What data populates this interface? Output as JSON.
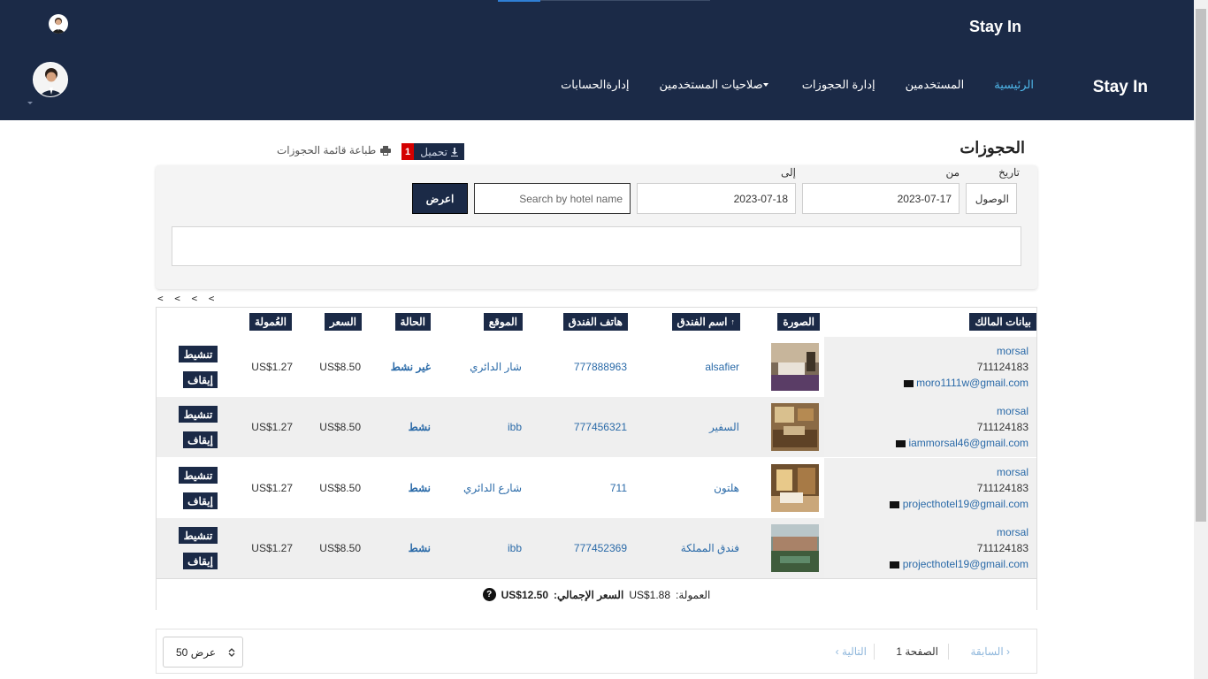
{
  "header": {
    "brand_small": "Stay In",
    "brand_main": "Stay In",
    "nav": [
      {
        "label": "الرئيسية",
        "active": true
      },
      {
        "label": "المستخدمين",
        "active": false
      },
      {
        "label": "إدارة الحجوزات",
        "active": false
      },
      {
        "label": "صلاحيات المستخدمين",
        "active": false,
        "dropdown": true
      },
      {
        "label": "إدارةالحسابات",
        "active": false
      }
    ]
  },
  "page": {
    "title": "الحجوزات",
    "download_label": "تحميل",
    "download_badge": "1",
    "print_label": "طباعة قائمة الحجوزات"
  },
  "filters": {
    "date_label": "تاريخ",
    "from_label": "من",
    "to_label": "إلى",
    "date_type_value": "الوصول",
    "from_value": "2023-07-17",
    "to_value": "2023-07-18",
    "search_placeholder": "Search by hotel name",
    "show_button": "اعرض"
  },
  "pager_arrows": "< < < <",
  "table": {
    "headers": {
      "owner": "بيانات المالك",
      "image": "الصورة",
      "hotel_name": "اسم الفندق",
      "hotel_phone": "هاتف الفندق",
      "location": "الموقع",
      "status": "الحالة",
      "price": "السعر",
      "commission": "العُمولة"
    },
    "rows": [
      {
        "owner_name": "morsal",
        "owner_phone": "711124183",
        "owner_email": "moro1111w@gmail.com",
        "hotel_name": "alsafier",
        "hotel_phone": "777888963",
        "location": "شار الدائري",
        "status": "غير نشط",
        "price": "US$8.50",
        "commission": "US$1.27",
        "activate": "تنشيط",
        "stop": "إيقاف"
      },
      {
        "owner_name": "morsal",
        "owner_phone": "711124183",
        "owner_email": "iammorsal46@gmail.com",
        "hotel_name": "السفير",
        "hotel_phone": "777456321",
        "location": "ibb",
        "status": "نشط",
        "price": "US$8.50",
        "commission": "US$1.27",
        "activate": "تنشيط",
        "stop": "إيقاف"
      },
      {
        "owner_name": "morsal",
        "owner_phone": "711124183",
        "owner_email": "projecthotel19@gmail.com",
        "hotel_name": "هلتون",
        "hotel_phone": "711",
        "location": "شارع الدائري",
        "status": "نشط",
        "price": "US$8.50",
        "commission": "US$1.27",
        "activate": "تنشيط",
        "stop": "إيقاف"
      },
      {
        "owner_name": "morsal",
        "owner_phone": "711124183",
        "owner_email": "projecthotel19@gmail.com",
        "hotel_name": "فندق المملكة",
        "hotel_phone": "777452369",
        "location": "ibb",
        "status": "نشط",
        "price": "US$8.50",
        "commission": "US$1.27",
        "activate": "تنشيط",
        "stop": "إيقاف"
      }
    ]
  },
  "totals": {
    "commission_label": "العمولة:",
    "commission_value": "US$1.88",
    "total_label": "السعر الإجمالي:",
    "total_value": "US$12.50"
  },
  "footer": {
    "per_page": "عرض 50",
    "prev": "السابقة",
    "page": "الصفحة 1",
    "next": "التالية"
  },
  "colors": {
    "navy": "#1b2a47",
    "link": "#2a6aa8",
    "active_nav": "#4fb6e8",
    "badge": "#d40000"
  }
}
